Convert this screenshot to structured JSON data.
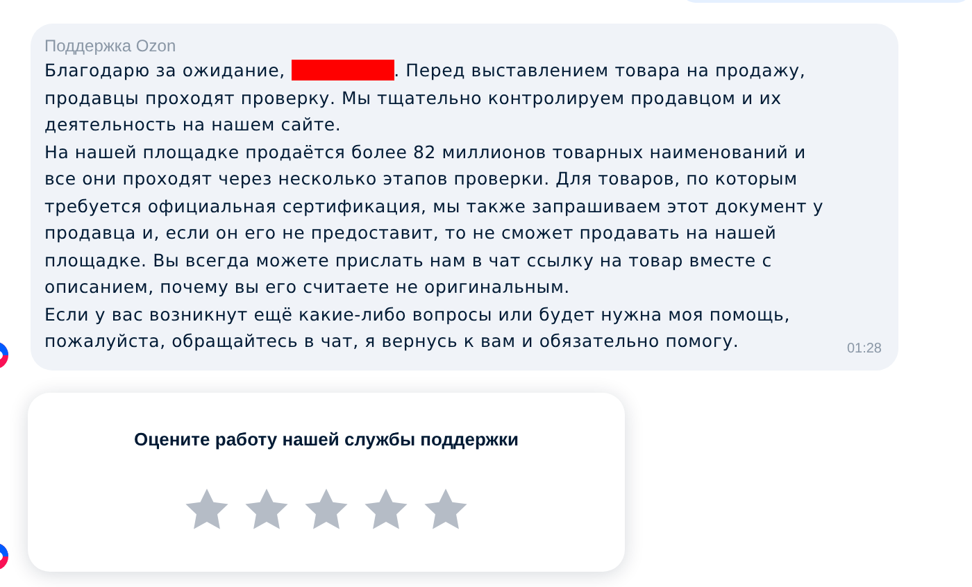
{
  "message": {
    "sender": "Поддержка Ozon",
    "greeting_before": "Благодарю за ожидание, ",
    "redacted": true,
    "greeting_after": ". Перед выставлением товара на продажу,",
    "greeting_rest": "продавцы проходят проверку. Мы тщательно контролируем продавцом и их деятельность на нашем сайте.",
    "paragraphs": [
      "На нашей площадке продаётся более 82 миллионов товарных наименований и все они проходят через несколько этапов проверки. Для товаров, по которым требуется официальная сертификация, мы также запрашиваем этот документ у продавца и, если он его не предоставит, то не сможет продавать на нашей площадке. Вы всегда можете прислать нам в чат ссылку на товар вместе с описанием, почему вы его считаете не оригинальным.",
      "Если у вас возникнут ещё какие-либо вопросы или будет нужна моя помощь, пожалуйста, обращайтесь в чат, я вернусь к вам и обязательно помогу."
    ],
    "time": "01:28"
  },
  "rating": {
    "title": "Оцените работу нашей службы поддержки",
    "stars": 0
  }
}
